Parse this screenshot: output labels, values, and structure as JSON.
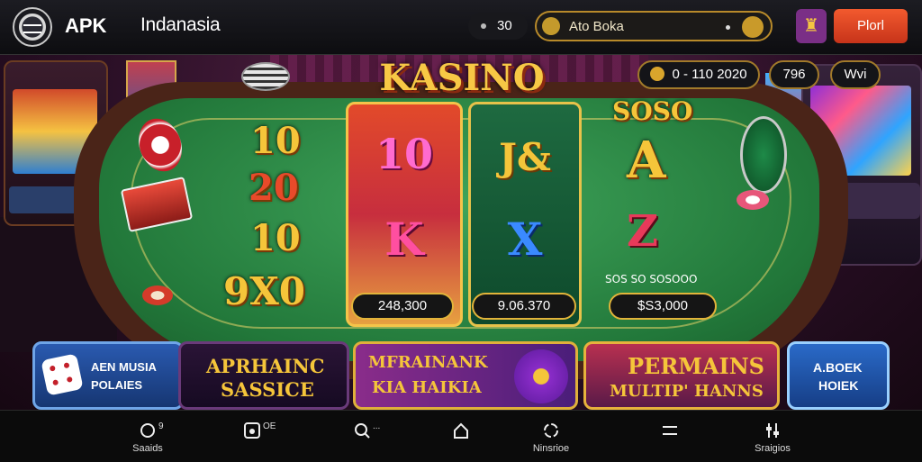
{
  "header": {
    "logo_icon": "apk-logo-icon",
    "app_title": "APK",
    "region": "Indanasia",
    "coins": "30",
    "search_text": "Ato Boka",
    "crown_icon": "crown-icon",
    "play_label": "Plorl"
  },
  "scene": {
    "title": "KASINO",
    "balance": "0 - 110 2020",
    "badge_796": "796",
    "badge_wins": "Wvi",
    "left_numbers": [
      "10",
      "20",
      "10"
    ],
    "left_bottom": "9X0",
    "reel1": {
      "top": "10",
      "middle": "K",
      "pill": "248,300"
    },
    "reel2": {
      "top": "J&",
      "middle": "X",
      "pill": "9.06.370"
    },
    "right": {
      "title": "SOSO",
      "letter_a": "A",
      "letter_z": "Z",
      "caption": "SOS SO SOSOOO",
      "pill": "$S3,000"
    }
  },
  "tiles": [
    {
      "line1": "AEN MUSIA",
      "line2": "POLAIES"
    },
    {
      "line1": "APRHAINC",
      "line2": "SASSICE"
    },
    {
      "line1": "MFRAINANK",
      "line2": "KIA HAIKIA"
    },
    {
      "line1": "PERMAINS",
      "line2": "MULTIP' HANNS"
    },
    {
      "line1": "A.BOEK",
      "line2": "HOIEK"
    }
  ],
  "nav": [
    {
      "label": "Saaids",
      "sub": "9"
    },
    {
      "label": "",
      "sub": "OE"
    },
    {
      "label": "",
      "sub": "..."
    },
    {
      "label": "",
      "sub": ""
    },
    {
      "label": "Ninsrioe",
      "sub": ""
    },
    {
      "label": "",
      "sub": ""
    },
    {
      "label": "Sraigios",
      "sub": ""
    }
  ],
  "colors": {
    "accent": "#e24a2a",
    "gold": "#f5c53a",
    "felt": "#22783a"
  }
}
